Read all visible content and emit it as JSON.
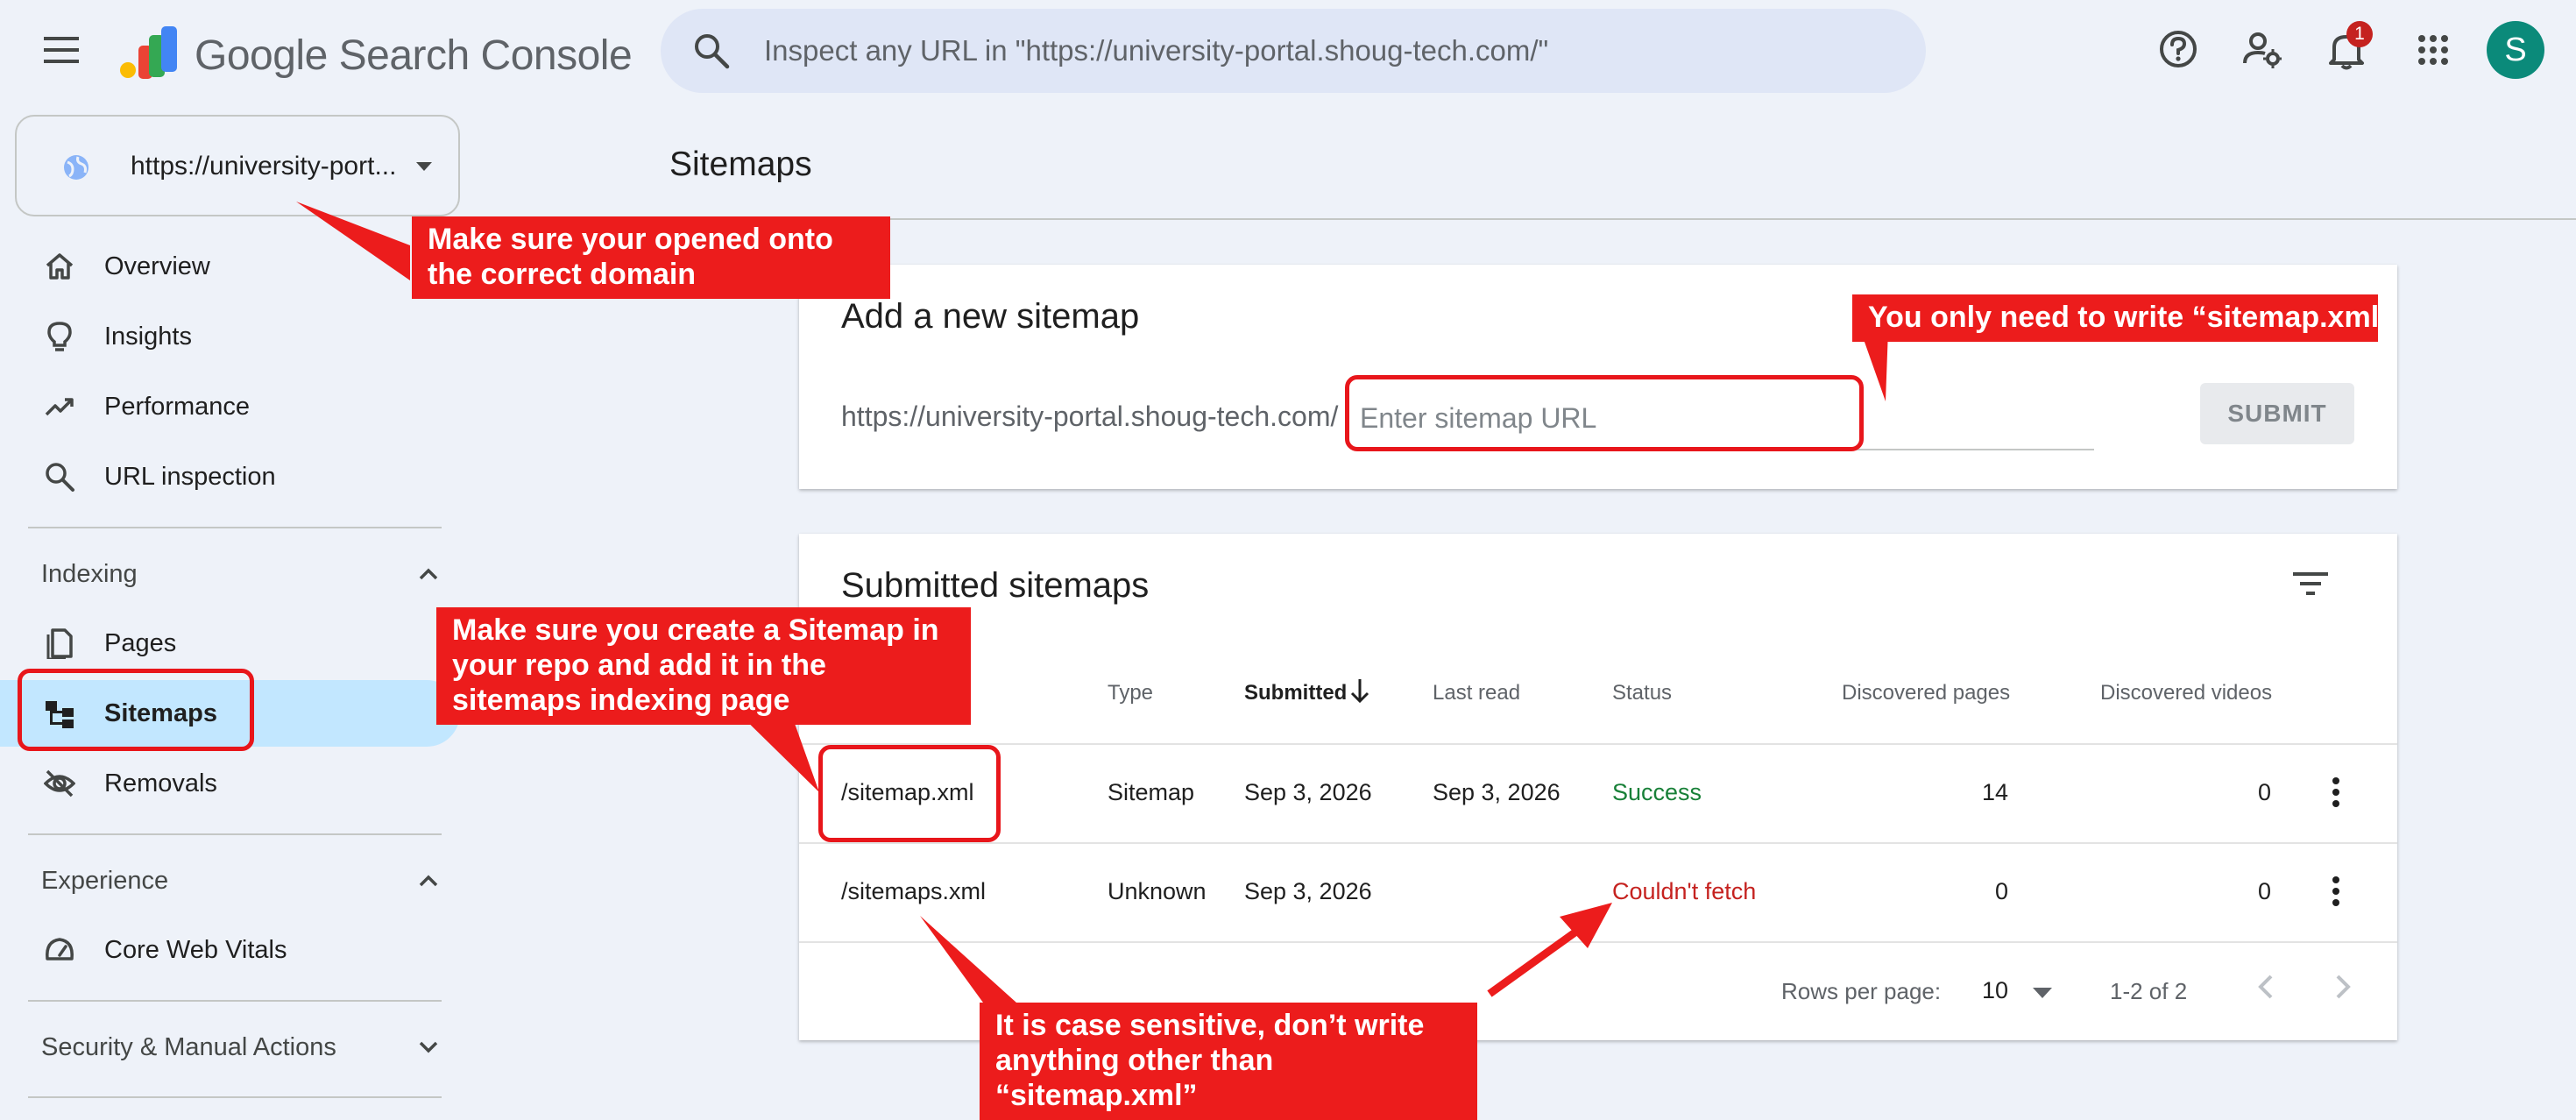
{
  "app": {
    "title_google": "Google",
    "title_product": "Search Console",
    "logo_icon": "search-console-logo-icon"
  },
  "search": {
    "placeholder": "Inspect any URL in \"https://university-portal.shoug-tech.com/\""
  },
  "header": {
    "notification_count": "1",
    "avatar_letter": "S"
  },
  "property": {
    "label": "https://university-port..."
  },
  "sidebar": {
    "items": [
      {
        "label": "Overview",
        "icon": "home-icon"
      },
      {
        "label": "Insights",
        "icon": "lightbulb-icon"
      },
      {
        "label": "Performance",
        "icon": "trending-up-icon"
      },
      {
        "label": "URL inspection",
        "icon": "search-icon"
      }
    ],
    "indexing": {
      "heading": "Indexing",
      "items": [
        {
          "label": "Pages",
          "icon": "pages-icon"
        },
        {
          "label": "Sitemaps",
          "icon": "sitemap-icon",
          "selected": true
        },
        {
          "label": "Removals",
          "icon": "eye-off-icon"
        }
      ]
    },
    "experience": {
      "heading": "Experience",
      "items": [
        {
          "label": "Core Web Vitals",
          "icon": "speedometer-icon"
        }
      ]
    },
    "security": {
      "heading": "Security & Manual Actions"
    }
  },
  "main": {
    "page_title": "Sitemaps",
    "add_sitemap": {
      "title": "Add a new sitemap",
      "url_prefix": "https://university-portal.shoug-tech.com/",
      "input_placeholder": "Enter sitemap URL",
      "input_value": "",
      "submit_label": "SUBMIT"
    },
    "submitted": {
      "title": "Submitted sitemaps",
      "columns": [
        "Type",
        "Submitted",
        "Last read",
        "Status",
        "Discovered pages",
        "Discovered videos"
      ],
      "sort_column": "Submitted",
      "sort_direction": "descending",
      "rows": [
        {
          "sitemap": "/sitemap.xml",
          "type": "Sitemap",
          "submitted": "Sep 3, 2026",
          "last_read": "Sep 3, 2026",
          "status": "Success",
          "pages": "14",
          "videos": "0"
        },
        {
          "sitemap": "/sitemaps.xml",
          "type": "Unknown",
          "submitted": "Sep 3, 2026",
          "last_read": "",
          "status": "Couldn't fetch",
          "pages": "0",
          "videos": "0"
        }
      ],
      "footer": {
        "rows_per_page_label": "Rows per page:",
        "rows_per_page_value": "10",
        "range": "1-2 of 2"
      }
    }
  },
  "annotations": {
    "domain_note": "Make sure your opened onto the correct domain",
    "sitemap_xml_note": "You only need to write “sitemap.xml”",
    "create_sitemap_note": "Make sure you create a Sitemap in your repo and add it in the sitemaps indexing page",
    "case_note": "It is case sensitive, don’t write anything other than “sitemap.xml”"
  },
  "colors": {
    "accent": "#0b57d0",
    "selected_nav": "#c2e7ff",
    "success": "#188038",
    "error": "#c5221f",
    "annotation_red": "#ec1c1c",
    "avatar": "#0b8a7a"
  }
}
